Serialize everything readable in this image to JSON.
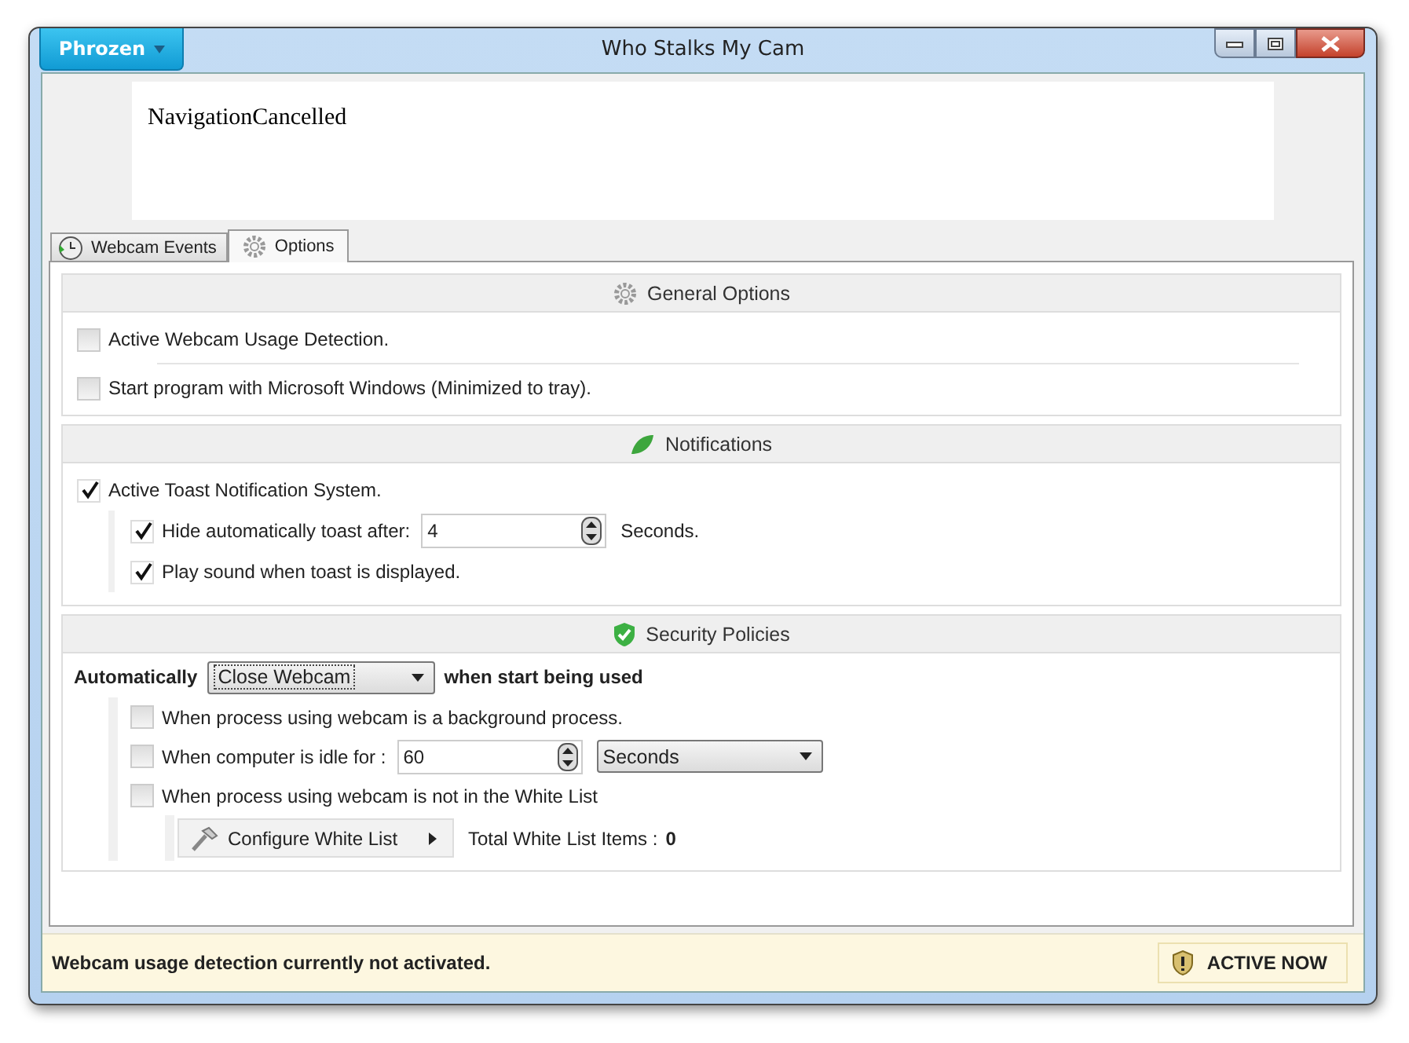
{
  "window": {
    "title": "Who Stalks My Cam",
    "menu_button": "Phrozen"
  },
  "browser": {
    "text": "NavigationCancelled"
  },
  "tabs": [
    {
      "label": "Webcam Events",
      "selected": false
    },
    {
      "label": "Options",
      "selected": true
    }
  ],
  "general_options": {
    "title": "General Options",
    "options": [
      {
        "label": "Active Webcam Usage Detection.",
        "checked": false
      },
      {
        "label": "Start program with Microsoft Windows (Minimized to tray).",
        "checked": false
      }
    ]
  },
  "notifications": {
    "title": "Notifications",
    "active_toast": {
      "label": "Active Toast Notification System.",
      "checked": true
    },
    "hide_toast": {
      "label": "Hide automatically toast after:",
      "checked": true,
      "value": "4",
      "unit": "Seconds."
    },
    "play_sound": {
      "label": "Play sound when toast is displayed.",
      "checked": true
    }
  },
  "security_policies": {
    "title": "Security Policies",
    "prefix": "Automatically",
    "action": "Close Webcam",
    "suffix": "when start being used",
    "conditions": [
      {
        "kind": "plain",
        "label": "When process using webcam is a background process.",
        "checked": false
      },
      {
        "kind": "idle",
        "label": "When computer is idle for :",
        "checked": false,
        "value": "60",
        "unit": "Seconds"
      },
      {
        "kind": "plain",
        "label": "When process using webcam is not in the White List",
        "checked": false
      }
    ],
    "white_list_button": "Configure White List",
    "total_label": "Total  White List Items :",
    "total_value": "0"
  },
  "status_bar": {
    "message": "Webcam usage detection currently not activated.",
    "button": "ACTIVE NOW"
  }
}
